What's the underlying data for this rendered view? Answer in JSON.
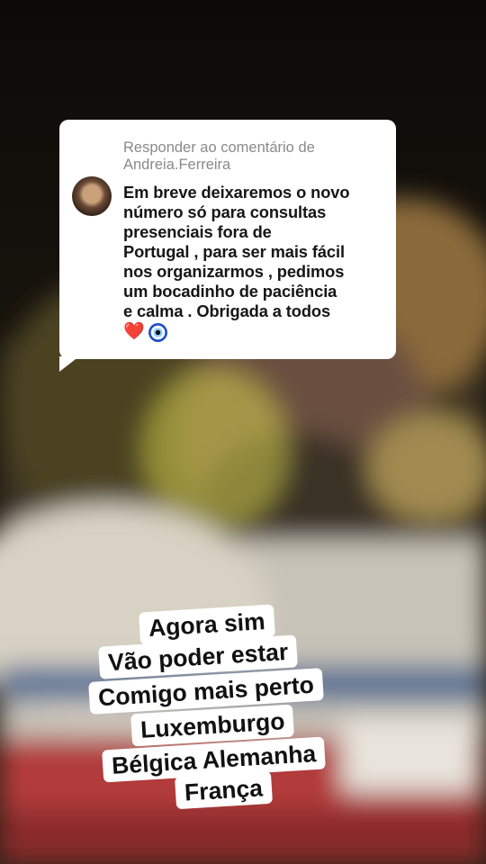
{
  "reply": {
    "header": "Responder ao comentário de Andreia.Ferreira",
    "lines": [
      "Em breve deixaremos o novo",
      "número só para consultas",
      "presenciais fora de",
      "Portugal , para ser mais fácil",
      "nos organizarmos , pedimos",
      "um bocadinho de paciência",
      "e calma . Obrigada a todos"
    ],
    "emoji_heart": "❤️",
    "emoji_eye_icon": "nazar-amulet"
  },
  "caption": {
    "lines": [
      "Agora sim",
      "Vão poder estar",
      "Comigo mais perto",
      "Luxemburgo",
      "Bélgica Alemanha",
      "França"
    ]
  }
}
